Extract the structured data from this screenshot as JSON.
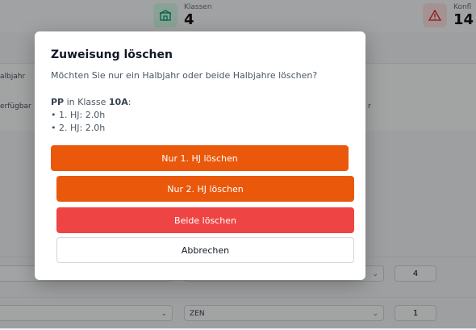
{
  "background": {
    "stats": [
      {
        "label": "Klassen",
        "value": "4",
        "icon": "graduation-cap-icon"
      },
      {
        "label": "Konfl",
        "value": "14",
        "icon": "warning-triangle-icon"
      }
    ],
    "card_labels": [
      "albjahr",
      "erfügbar",
      "r"
    ],
    "rows": [
      {
        "subject": "",
        "count": "4"
      },
      {
        "subject": "ZEN",
        "count": "1"
      }
    ]
  },
  "modal": {
    "title": "Zuweisung löschen",
    "subtitle": "Möchten Sie nur ein Halbjahr oder beide Halbjahre löschen?",
    "subject": "PP",
    "in_class_text": " in Klasse ",
    "class_name": "10A",
    "colon": ":",
    "lines": [
      "• 1. HJ: 2.0h",
      "• 2. HJ: 2.0h"
    ],
    "buttons": {
      "delete_hj1": "Nur 1. HJ löschen",
      "delete_hj2": "Nur 2. HJ löschen",
      "delete_both": "Beide löschen",
      "cancel": "Abbrechen"
    }
  },
  "colors": {
    "orange": "#ea580c",
    "red": "#ef4444"
  }
}
